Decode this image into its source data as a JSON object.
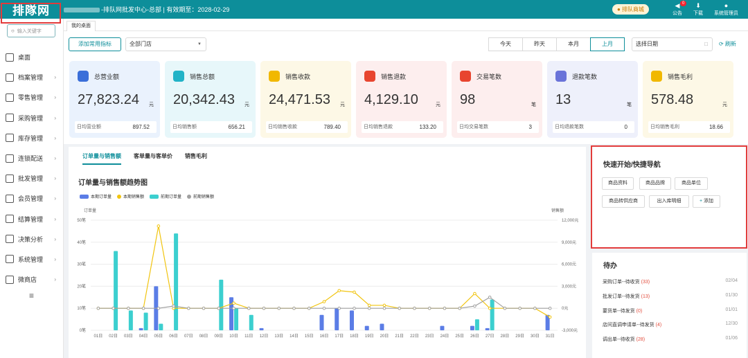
{
  "topbar": {
    "logo": "排隊网",
    "store_info": "-排队网批发中心-总部 | 有效期至：2028-02-29",
    "mall_button": "排队商城",
    "icons": [
      {
        "name": "announcement-icon",
        "label": "公告",
        "badge": "0",
        "glyph": "◀"
      },
      {
        "name": "download-icon",
        "label": "下载",
        "glyph": "⬇"
      },
      {
        "name": "user-icon",
        "label": "系统管理员",
        "glyph": "●"
      }
    ]
  },
  "sidebar": {
    "search_placeholder": "输入关键字",
    "items": [
      {
        "label": "桌面",
        "arrow": ""
      },
      {
        "label": "档案管理",
        "arrow": "›"
      },
      {
        "label": "零售管理",
        "arrow": "›"
      },
      {
        "label": "采购管理",
        "arrow": "›"
      },
      {
        "label": "库存管理",
        "arrow": "›"
      },
      {
        "label": "连锁配送",
        "arrow": "›"
      },
      {
        "label": "批发管理",
        "arrow": "›"
      },
      {
        "label": "会员管理",
        "arrow": "›"
      },
      {
        "label": "结算管理",
        "arrow": "›"
      },
      {
        "label": "决策分析",
        "arrow": "›"
      },
      {
        "label": "系统管理",
        "arrow": "›"
      },
      {
        "label": "微商店",
        "arrow": "›"
      }
    ]
  },
  "tabs": {
    "home": "我的桌面"
  },
  "toolbar": {
    "add_metric": "添加常用指标",
    "store_select": "全部门店",
    "periods": [
      "今天",
      "昨天",
      "本月",
      "上月"
    ],
    "active_period": "上月",
    "date_placeholder": "选择日期",
    "refresh": "刷新"
  },
  "kpis": [
    {
      "title": "总营业额",
      "value": "27,823.24",
      "unit": "元",
      "foot_label": "日均营业额",
      "foot_value": "897.52",
      "bg": "#eaf2fd",
      "icon_color": "#3b6fd9"
    },
    {
      "title": "销售总额",
      "value": "20,342.43",
      "unit": "元",
      "foot_label": "日均销售额",
      "foot_value": "656.21",
      "bg": "#e7f7fa",
      "icon_color": "#21b3c7"
    },
    {
      "title": "销售收款",
      "value": "24,471.53",
      "unit": "元",
      "foot_label": "日均销售收款",
      "foot_value": "789.40",
      "bg": "#fdf8e6",
      "icon_color": "#f1b800"
    },
    {
      "title": "销售退款",
      "value": "4,129.10",
      "unit": "元",
      "foot_label": "日均销售退款",
      "foot_value": "133.20",
      "bg": "#fdeeee",
      "icon_color": "#e8452f"
    },
    {
      "title": "交易笔数",
      "value": "98",
      "unit": "笔",
      "foot_label": "日均交易笔数",
      "foot_value": "3",
      "bg": "#fdeeee",
      "icon_color": "#e8452f"
    },
    {
      "title": "退款笔数",
      "value": "13",
      "unit": "笔",
      "foot_label": "日均退款笔数",
      "foot_value": "0",
      "bg": "#eef0fb",
      "icon_color": "#6a73d9"
    },
    {
      "title": "销售毛利",
      "value": "578.48",
      "unit": "元",
      "foot_label": "日均销售毛利",
      "foot_value": "18.66",
      "bg": "#fdf8e6",
      "icon_color": "#f1b800"
    }
  ],
  "chart_panel": {
    "tabs": [
      "订单量与销售额",
      "客单量与客单价",
      "销售毛利"
    ],
    "active_tab": "订单量与销售额",
    "title": "订单量与销售额趋势图"
  },
  "chart_data": {
    "type": "bar",
    "y_left_label": "订单量",
    "y_right_label": "销售额",
    "y_left_ticks": [
      "0笔",
      "10笔",
      "20笔",
      "30笔",
      "40笔",
      "50笔"
    ],
    "y_right_ticks": [
      "-3,000元",
      "0元",
      "3,000元",
      "6,000元",
      "9,000元",
      "12,000元"
    ],
    "ylim_left": [
      0,
      50
    ],
    "ylim_right": [
      -3000,
      12000
    ],
    "categories": [
      "01日",
      "02日",
      "03日",
      "04日",
      "05日",
      "06日",
      "07日",
      "08日",
      "09日",
      "10日",
      "11日",
      "12日",
      "13日",
      "14日",
      "15日",
      "16日",
      "17日",
      "18日",
      "19日",
      "20日",
      "21日",
      "22日",
      "23日",
      "24日",
      "25日",
      "26日",
      "27日",
      "28日",
      "29日",
      "30日",
      "31日"
    ],
    "series": [
      {
        "name": "本期订单量",
        "kind": "bar",
        "color": "#5b7de6",
        "values": [
          0,
          0,
          0,
          1,
          20,
          0,
          0,
          0,
          0,
          15,
          0,
          1,
          0,
          0,
          0,
          7,
          10,
          9,
          2,
          3,
          0,
          0,
          0,
          2,
          0,
          2,
          1,
          0,
          0,
          0,
          7
        ]
      },
      {
        "name": "前期订单量",
        "kind": "bar",
        "color": "#3ccfcf",
        "values": [
          0,
          36,
          9,
          8,
          3,
          44,
          0,
          0,
          23,
          10,
          7,
          0,
          0,
          0,
          0,
          0,
          0,
          0,
          0,
          0,
          0,
          0,
          0,
          0,
          0,
          5,
          14,
          0,
          0,
          0,
          0
        ]
      },
      {
        "name": "本期销售额",
        "kind": "line",
        "color": "#f1c40f",
        "values": [
          0,
          0,
          0,
          0,
          11200,
          0,
          0,
          0,
          0,
          700,
          0,
          0,
          0,
          0,
          0,
          900,
          2400,
          2200,
          400,
          400,
          0,
          0,
          0,
          0,
          0,
          2000,
          0,
          0,
          0,
          0,
          -1200
        ]
      },
      {
        "name": "前期销售额",
        "kind": "line",
        "color": "#a0a0a0",
        "values": [
          0,
          0,
          0,
          0,
          0,
          300,
          0,
          0,
          0,
          0,
          0,
          0,
          0,
          0,
          0,
          0,
          0,
          0,
          0,
          0,
          0,
          0,
          0,
          0,
          0,
          300,
          1500,
          0,
          0,
          0,
          0
        ]
      }
    ],
    "legend_position": "top-left",
    "grid": true
  },
  "quick_nav": {
    "title": "快速开始/快捷导航",
    "buttons": [
      "商品资料",
      "商品品牌",
      "商品单位",
      "商品转供应商",
      "出入库明细",
      "添加"
    ]
  },
  "todo": {
    "title": "待办",
    "items": [
      {
        "label": "采购订单--待收货",
        "count": "(33)",
        "date": "02/04"
      },
      {
        "label": "批发订单--待发货",
        "count": "(13)",
        "date": "01/30"
      },
      {
        "label": "要货单--待发货",
        "count": "(0)",
        "date": "01/01"
      },
      {
        "label": "店间直调申请单--待发货",
        "count": "(4)",
        "date": "12/30"
      },
      {
        "label": "调出单--待收货",
        "count": "(28)",
        "date": "01/06"
      }
    ]
  }
}
